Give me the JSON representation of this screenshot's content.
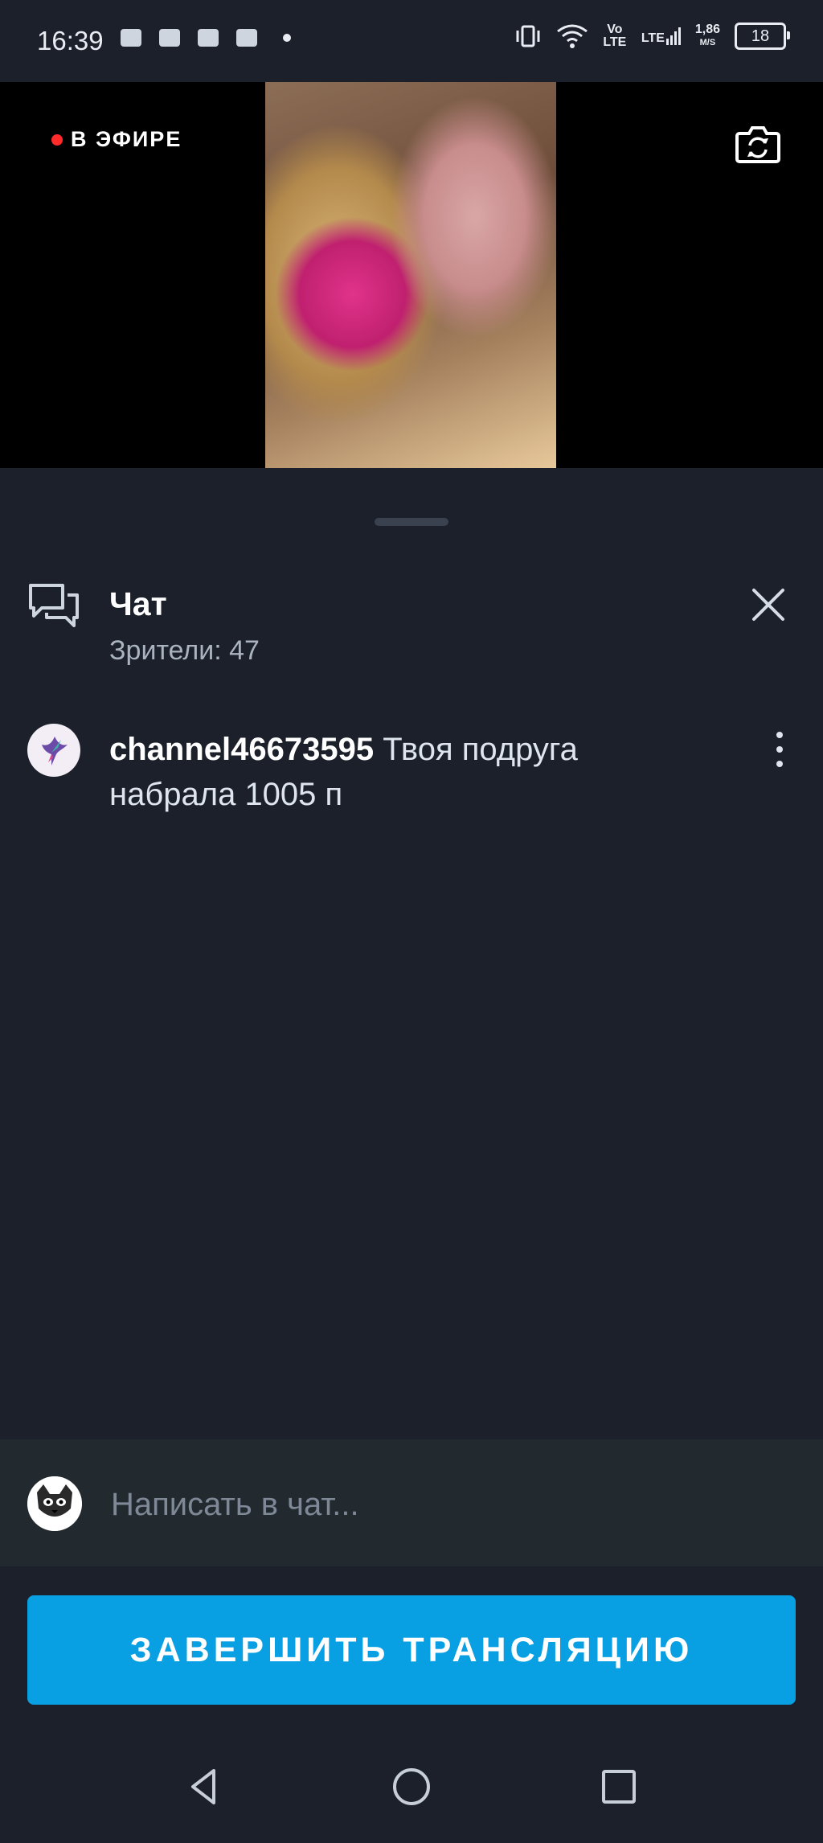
{
  "status_bar": {
    "time": "16:39",
    "volte": "Vo LTE",
    "lte": "LTE",
    "net_speed_value": "1,86",
    "net_speed_unit": "M/S",
    "battery": "18"
  },
  "stream": {
    "live_label": "В ЭФИРЕ",
    "live_color": "#ff2a2a"
  },
  "chat": {
    "title": "Чат",
    "viewers": "Зрители: 47",
    "messages": [
      {
        "user": "channel46673595",
        "text": "Твоя подруга набрала 1005 п"
      }
    ],
    "input_placeholder": "Написать в чат..."
  },
  "end_button": {
    "label": "ЗАВЕРШИТЬ ТРАНСЛЯЦИЮ",
    "color": "#089fe3"
  },
  "icons": {
    "camera_flip": "camera-switch-icon",
    "chat": "chat-bubbles-icon",
    "close": "close-icon",
    "more": "more-vertical-icon",
    "back": "nav-back-icon",
    "home": "nav-home-icon",
    "recents": "nav-recents-icon"
  }
}
